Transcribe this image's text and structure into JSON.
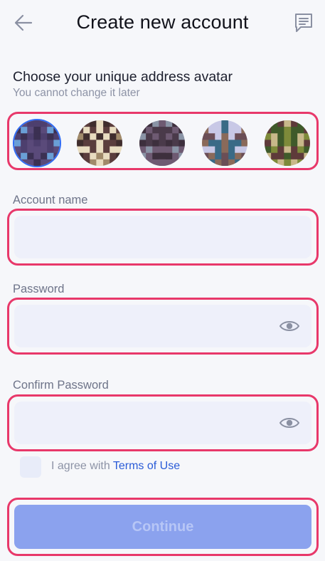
{
  "header": {
    "title": "Create new account",
    "back_icon": "arrow-left-icon",
    "chat_icon": "chat-icon"
  },
  "avatar_section": {
    "title": "Choose your unique address avatar",
    "subtitle": "You cannot change it later",
    "selected_index": 0,
    "avatars": [
      {
        "palette": [
          "#4d3f6e",
          "#6a9fd6",
          "#5a4a7a",
          "#3b3052"
        ]
      },
      {
        "palette": [
          "#5a3d3d",
          "#e8dcc0",
          "#a08a6a",
          "#3f2d2d"
        ]
      },
      {
        "palette": [
          "#4a3a4a",
          "#8a94a6",
          "#3d2f3d",
          "#6e5a72"
        ]
      },
      {
        "palette": [
          "#6b4e56",
          "#c8c8e6",
          "#3a6a86",
          "#8a6a5a"
        ]
      },
      {
        "palette": [
          "#5e3a3a",
          "#7e8a3a",
          "#c8b88a",
          "#3f5a2a"
        ]
      }
    ]
  },
  "fields": {
    "account_name": {
      "label": "Account name",
      "value": "",
      "placeholder": ""
    },
    "password": {
      "label": "Password",
      "value": "",
      "placeholder": "",
      "toggle_icon": "eye-icon"
    },
    "confirm_password": {
      "label": "Confirm Password",
      "value": "",
      "placeholder": "",
      "toggle_icon": "eye-icon"
    }
  },
  "agreement": {
    "prefix": "I agree with ",
    "link": "Terms of Use",
    "checked": false
  },
  "continue_label": "Continue",
  "colors": {
    "highlight": "#e8386a",
    "accent": "#2a5bd7",
    "button": "#8ba2ee"
  }
}
